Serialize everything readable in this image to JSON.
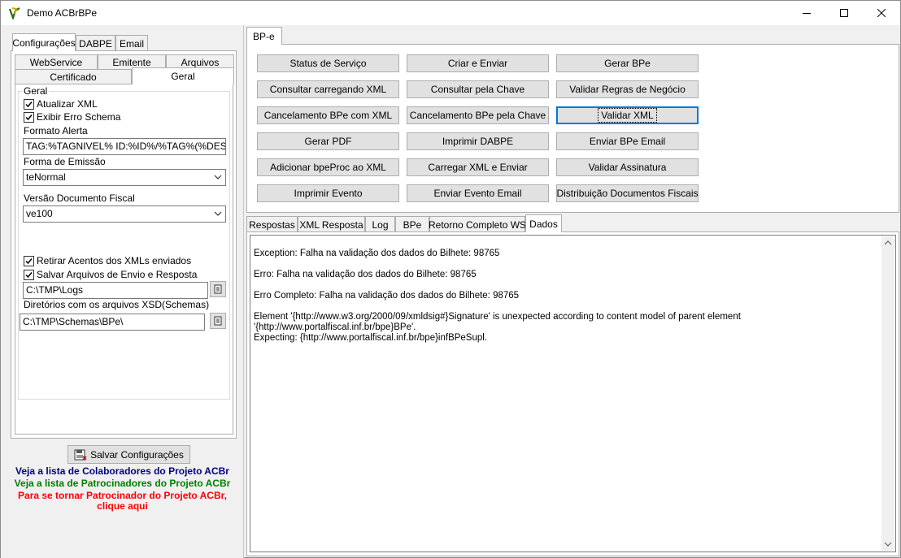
{
  "window": {
    "title": "Demo ACBrBPe"
  },
  "left": {
    "tabs": [
      "Configurações",
      "DABPE",
      "Email"
    ],
    "subtabs_row1": [
      "WebService",
      "Emitente",
      "Arquivos"
    ],
    "subtabs_row2": [
      "Certificado",
      "Geral"
    ],
    "group_title": "Geral",
    "check_atualizar": "Atualizar XML",
    "check_exibir": "Exibir Erro Schema",
    "label_formato": "Formato Alerta",
    "formato_value": "TAG:%TAGNIVEL% ID:%ID%/%TAG%(%DESCRICAO%)",
    "label_forma": "Forma de Emissão",
    "forma_value": "teNormal",
    "label_versao": "Versão Documento Fiscal",
    "versao_value": "ve100",
    "check_retirar": "Retirar Acentos dos XMLs enviados",
    "check_salvar": "Salvar Arquivos de Envio e Resposta",
    "logs_value": "C:\\TMP\\Logs",
    "label_xsd": "Diretórios com os arquivos XSD(Schemas)",
    "xsd_value": "C:\\TMP\\Schemas\\BPe\\",
    "save_button": "Salvar Configurações",
    "link_colab": "Veja a lista de Colaboradores do Projeto ACBr",
    "link_patroc": "Veja a lista de Patrocinadores do Projeto ACBr",
    "link_tornar1": "Para se tornar Patrocinador do Projeto ACBr,",
    "link_tornar2": "clique aqui"
  },
  "right": {
    "top_tab": "BP-e",
    "buttons": [
      [
        "Status de Serviço",
        "Criar e Enviar",
        "Gerar BPe"
      ],
      [
        "Consultar carregando XML",
        "Consultar pela Chave",
        "Validar Regras de Negócio"
      ],
      [
        "Cancelamento BPe com XML",
        "Cancelamento BPe pela Chave",
        "Validar XML"
      ],
      [
        "Gerar PDF",
        "Imprimir DABPE",
        "Enviar BPe Email"
      ],
      [
        "Adicionar bpeProc ao XML",
        "Carregar XML e Enviar",
        "Validar Assinatura"
      ],
      [
        "Imprimir Evento",
        "Enviar Evento Email",
        "Distribuição Documentos Fiscais"
      ]
    ],
    "result_tabs": [
      "Respostas",
      "XML Resposta",
      "Log",
      "BPe",
      "Retorno Completo WS",
      "Dados"
    ],
    "memo": {
      "line1": "Exception: Falha na validação dos dados do Bilhete: 98765",
      "line2": "Erro: Falha na validação dos dados do Bilhete: 98765",
      "line3": "Erro Completo: Falha na validação dos dados do Bilhete: 98765",
      "line4a": "Element '{http://www.w3.org/2000/09/xmldsig#}Signature' is unexpected according to content model of parent element '{http://www.portalfiscal.inf.br/bpe}BPe'.",
      "line4b": "Expecting: {http://www.portalfiscal.inf.br/bpe}infBPeSupl."
    }
  },
  "colors": {
    "link_colab": "#000080",
    "link_patroc": "#008000",
    "link_tornar": "#ff0000",
    "focus": "#0078d7"
  }
}
